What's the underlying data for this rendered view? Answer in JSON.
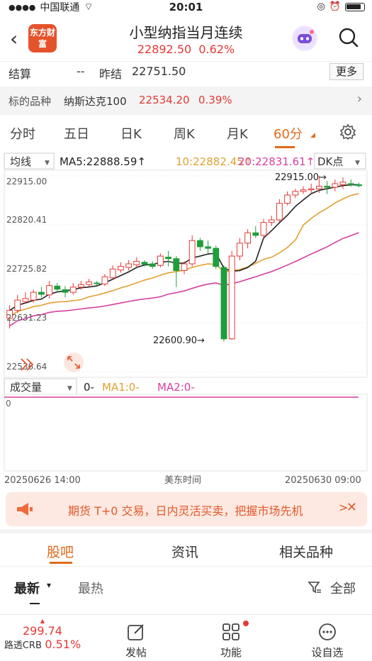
{
  "status": {
    "carrier": "中国联通",
    "time": "20:01"
  },
  "header": {
    "logo_text": "东方财富",
    "title": "小型纳指当月连续",
    "price": "22892.50",
    "change_pct": "0.62%"
  },
  "info": {
    "settle_label": "结算",
    "settle_value": "--",
    "prev_settle_label": "昨结",
    "prev_settle_value": "22751.50",
    "more_label": "更多",
    "underlying_label": "标的品种",
    "underlying_name": "纳斯达克100",
    "underlying_price": "22534.20",
    "underlying_pct": "0.39%"
  },
  "period_tabs": [
    "分时",
    "五日",
    "日K",
    "周K",
    "月K",
    "60分"
  ],
  "active_period_index": 5,
  "chart_data": {
    "type": "candlestick",
    "indicator_select": "均线",
    "ma_legend": {
      "ma5": "MA5:22888.59↑",
      "ma10": "10:22882.45↑",
      "ma20": "20:22831.61↑"
    },
    "ma_colors": {
      "ma5": "#222222",
      "ma10": "#e0a030",
      "ma20": "#d63fa0"
    },
    "dk_label": "DK点",
    "y_ticks": [
      "22915.00",
      "22820.41",
      "22725.82",
      "22631.23",
      "22536.64"
    ],
    "ylim": [
      22536.64,
      22915.0
    ],
    "high_label": "22915.00→",
    "low_label": "22600.90→",
    "volume_select": "成交量",
    "volume_legend": {
      "val": "0-",
      "ma1": "MA1:0-",
      "ma2": "MA2:0-"
    },
    "volume_zero": "0",
    "x_start": "20250626 14:00",
    "x_mid": "美东时间",
    "x_end": "20250630 09:00",
    "candles": [
      [
        22640,
        22655,
        22620,
        22665
      ],
      [
        22655,
        22675,
        22650,
        22685
      ],
      [
        22672,
        22678,
        22668,
        22690
      ],
      [
        22675,
        22690,
        22670,
        22695
      ],
      [
        22690,
        22686,
        22680,
        22700
      ],
      [
        22685,
        22703,
        22678,
        22712
      ],
      [
        22702,
        22696,
        22690,
        22708
      ],
      [
        22695,
        22690,
        22680,
        22702
      ],
      [
        22690,
        22700,
        22685,
        22708
      ],
      [
        22700,
        22705,
        22695,
        22712
      ],
      [
        22705,
        22710,
        22700,
        22716
      ],
      [
        22708,
        22707,
        22703,
        22712
      ],
      [
        22706,
        22720,
        22702,
        22725
      ],
      [
        22718,
        22735,
        22715,
        22742
      ],
      [
        22733,
        22740,
        22728,
        22748
      ],
      [
        22738,
        22745,
        22732,
        22752
      ],
      [
        22743,
        22750,
        22738,
        22758
      ],
      [
        22748,
        22744,
        22740,
        22752
      ],
      [
        22745,
        22740,
        22735,
        22750
      ],
      [
        22742,
        22760,
        22738,
        22765
      ],
      [
        22758,
        22755,
        22740,
        22770
      ],
      [
        22755,
        22732,
        22700,
        22760
      ],
      [
        22732,
        22745,
        22725,
        22750
      ],
      [
        22745,
        22790,
        22740,
        22800
      ],
      [
        22790,
        22778,
        22770,
        22795
      ],
      [
        22778,
        22775,
        22765,
        22790
      ],
      [
        22775,
        22740,
        22735,
        22780
      ],
      [
        22738,
        22600,
        22595,
        22742
      ],
      [
        22600,
        22760,
        22598,
        22770
      ],
      [
        22760,
        22785,
        22752,
        22795
      ],
      [
        22785,
        22805,
        22775,
        22812
      ],
      [
        22805,
        22800,
        22795,
        22818
      ],
      [
        22800,
        22825,
        22795,
        22832
      ],
      [
        22825,
        22830,
        22818,
        22838
      ],
      [
        22830,
        22862,
        22826,
        22870
      ],
      [
        22862,
        22878,
        22858,
        22885
      ],
      [
        22878,
        22885,
        22872,
        22890
      ],
      [
        22885,
        22888,
        22880,
        22895
      ],
      [
        22888,
        22890,
        22880,
        22900
      ],
      [
        22890,
        22895,
        22882,
        22915
      ],
      [
        22895,
        22893,
        22880,
        22905
      ],
      [
        22893,
        22900,
        22885,
        22908
      ],
      [
        22898,
        22903,
        22890,
        22912
      ],
      [
        22900,
        22898,
        22894,
        22908
      ],
      [
        22898,
        22896,
        22893,
        22902
      ]
    ]
  },
  "banner": {
    "text": "期货 T+0 交易，日内灵活买卖，把握市场先机",
    "close_label": "✕"
  },
  "sub_tabs": [
    "股吧",
    "资讯",
    "相关品种"
  ],
  "filter": {
    "latest": "最新",
    "hot": "最热",
    "all": "全部"
  },
  "bottom_bar": {
    "ticker_price": "299.74",
    "ticker_name": "路透CRB",
    "ticker_pct": "0.51%",
    "post_label": "发帖",
    "func_label": "功能",
    "watch_label": "设自选"
  }
}
